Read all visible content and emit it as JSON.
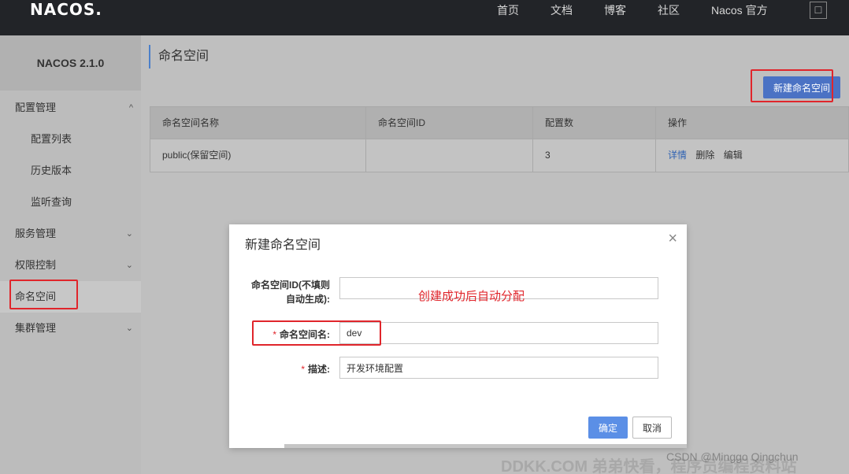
{
  "topbar": {
    "logo": "NACOS.",
    "nav": [
      "首页",
      "文档",
      "博客",
      "社区",
      "Nacos 官方"
    ],
    "box_glyph": "☐"
  },
  "sidebar": {
    "version": "NACOS 2.1.0",
    "items": [
      {
        "label": "配置管理",
        "chevron": "^"
      },
      {
        "label": "配置列表"
      },
      {
        "label": "历史版本"
      },
      {
        "label": "监听查询"
      },
      {
        "label": "服务管理",
        "chevron": "⌄"
      },
      {
        "label": "权限控制",
        "chevron": "⌄"
      },
      {
        "label": "命名空间"
      },
      {
        "label": "集群管理",
        "chevron": "⌄"
      }
    ]
  },
  "main": {
    "title": "命名空间",
    "create_button": "新建命名空间",
    "table": {
      "headers": [
        "命名空间名称",
        "命名空间ID",
        "配置数",
        "操作"
      ],
      "rows": [
        {
          "name": "public(保留空间)",
          "id": "",
          "count": "3",
          "actions": [
            "详情",
            "删除",
            "编辑"
          ]
        }
      ]
    }
  },
  "dialog": {
    "title": "新建命名空间",
    "close": "×",
    "fields": {
      "id_label_line1": "命名空间ID(不填则",
      "id_label_line2": "自动生成):",
      "id_value": "",
      "name_label": "命名空间名:",
      "name_value": "dev",
      "desc_label": "描述:",
      "desc_value": "开发环境配置",
      "required_mark": "*"
    },
    "hint": "创建成功后自动分配",
    "ok": "确定",
    "cancel": "取消"
  },
  "watermark": {
    "ddkk": "DDKK.COM 弟弟快看，程序员编程资料站",
    "csdn": "CSDN @Minggo Qingchun"
  },
  "colors": {
    "accent": "#4b72c4",
    "highlight": "#e0252b",
    "topbar": "#222428"
  }
}
